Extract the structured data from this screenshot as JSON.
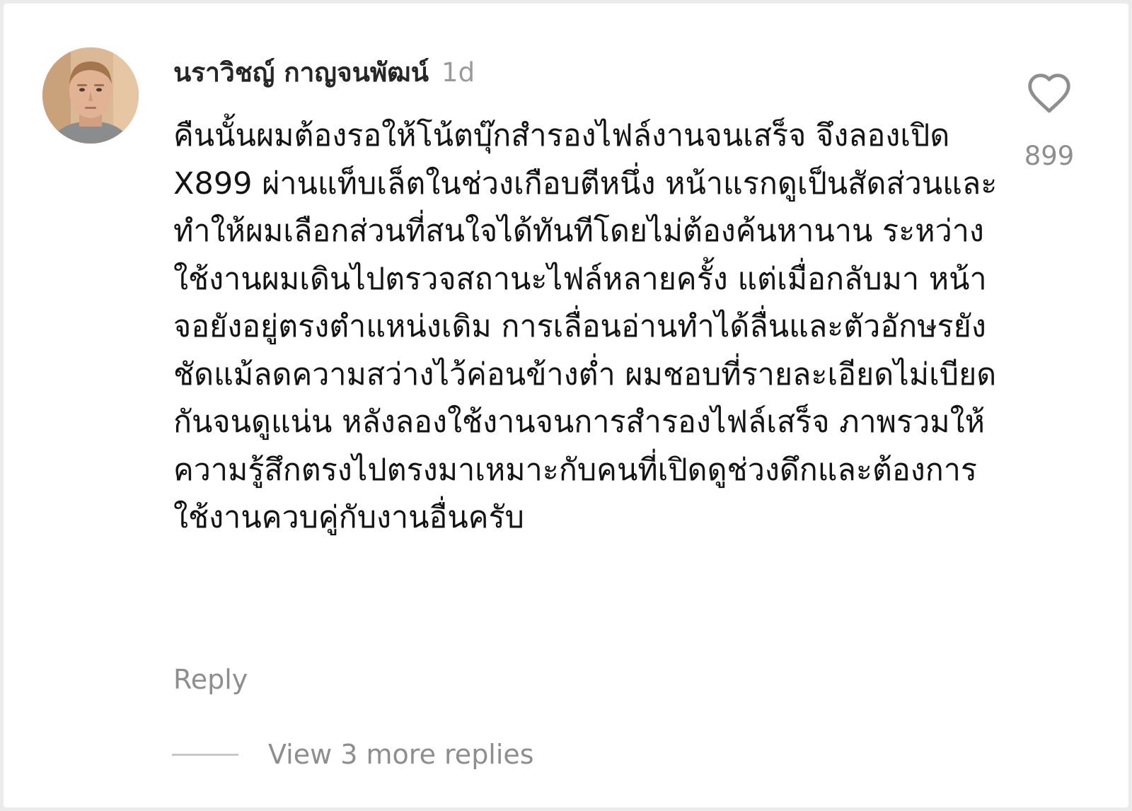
{
  "comment": {
    "avatar_icon": "user-avatar-photo",
    "username": "นราวิชญ์ กาญจนพัฒน์",
    "time": "1d",
    "text": "คืนนั้นผมต้องรอให้โน้ตบุ๊กสำรองไฟล์งานจนเสร็จ จึงลองเปิด X899 ผ่านแท็บเล็ตในช่วงเกือบตีหนึ่ง หน้าแรกดูเป็นสัดส่วนและทำให้ผมเลือกส่วนที่สนใจได้ทันทีโดยไม่ต้องค้นหานาน ระหว่างใช้งานผมเดินไปตรวจสถานะไฟล์หลายครั้ง แต่เมื่อกลับมา หน้าจอยังอยู่ตรงตำแหน่งเดิม การเลื่อนอ่านทำได้ลื่นและตัวอักษรยังชัดแม้ลดความสว่างไว้ค่อนข้างต่ำ ผมชอบที่รายละเอียดไม่เบียดกันจนดูแน่น หลังลองใช้งานจนการสำรองไฟล์เสร็จ ภาพรวมให้ความรู้สึกตรงไปตรงมาเหมาะกับคนที่เปิดดูช่วงดึกและต้องการใช้งานควบคู่กับงานอื่นครับ",
    "like_icon": "heart-outline-icon",
    "like_count": "899",
    "reply_label": "Reply",
    "view_replies_label": "View 3 more replies"
  },
  "colors": {
    "username": "#262626",
    "body_text": "#141414",
    "muted": "#8e8e8e",
    "divider": "#c8c8c8",
    "background": "#ffffff"
  }
}
